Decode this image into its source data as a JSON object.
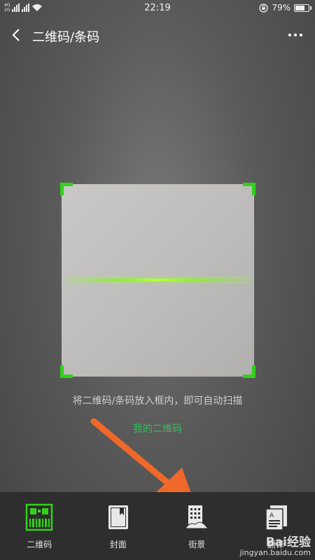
{
  "status": {
    "network": [
      "4G",
      "2G"
    ],
    "time": "22:19",
    "battery": "79%",
    "battery_level": 0.79
  },
  "header": {
    "title": "二维码/条码",
    "back_icon": "back-chevron-icon",
    "more_icon": "more-dots-icon"
  },
  "scanner": {
    "hint": "将二维码/条码放入框内，即可自动扫描",
    "my_qr_label": "我的二维码",
    "frame_color": "#33d11b",
    "link_color": "#2fc25b"
  },
  "tabs": [
    {
      "label": "二维码",
      "icon": "qr-barcode-icon",
      "active": true
    },
    {
      "label": "封面",
      "icon": "book-cover-icon",
      "active": false
    },
    {
      "label": "街景",
      "icon": "street-view-icon",
      "active": false
    },
    {
      "label": "翻译",
      "icon": "translate-doc-icon",
      "active": false
    }
  ],
  "watermark": {
    "brand": "Bai经验",
    "url": "jingyan.baidu.com"
  },
  "annotation_color": "#f0682a"
}
